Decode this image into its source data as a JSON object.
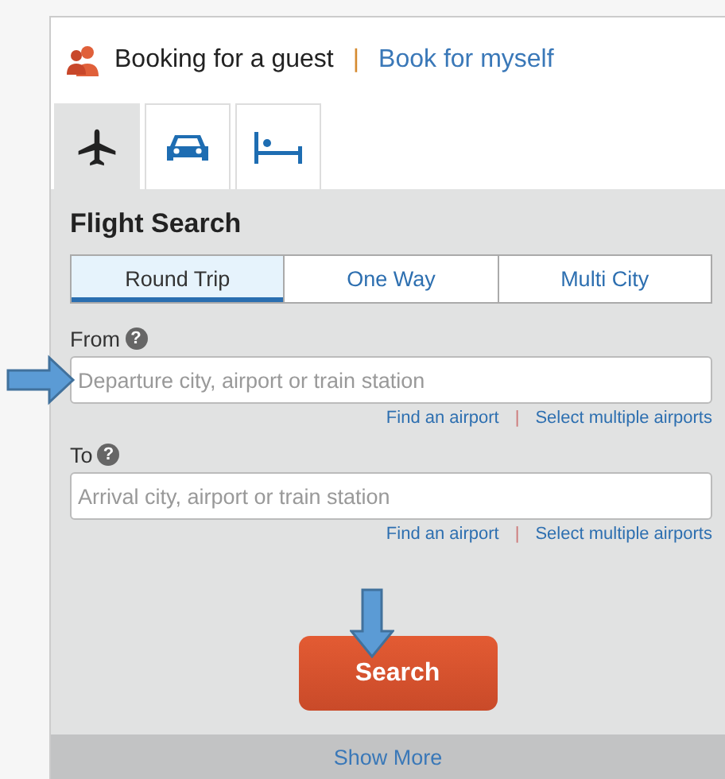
{
  "booking": {
    "current": "Booking for a guest",
    "separator": "|",
    "alternative": "Book for myself"
  },
  "tabs": [
    {
      "kind": "flight",
      "selected": true
    },
    {
      "kind": "car",
      "selected": false
    },
    {
      "kind": "hotel",
      "selected": false
    }
  ],
  "flight_search": {
    "title": "Flight Search",
    "trip_types": [
      {
        "label": "Round Trip",
        "selected": true
      },
      {
        "label": "One Way",
        "selected": false
      },
      {
        "label": "Multi City",
        "selected": false
      }
    ],
    "fields": [
      {
        "label": "From",
        "help": "?",
        "placeholder": "Departure city, airport or train station",
        "links": [
          "Find an airport",
          "Select multiple airports"
        ],
        "separator": "|",
        "annotated": true
      },
      {
        "label": "To",
        "help": "?",
        "placeholder": "Arrival city, airport or train station",
        "links": [
          "Find an airport",
          "Select multiple airports"
        ],
        "separator": "|",
        "annotated": false
      }
    ],
    "search_button": "Search",
    "search_annotated": true
  },
  "show_more": "Show More"
}
